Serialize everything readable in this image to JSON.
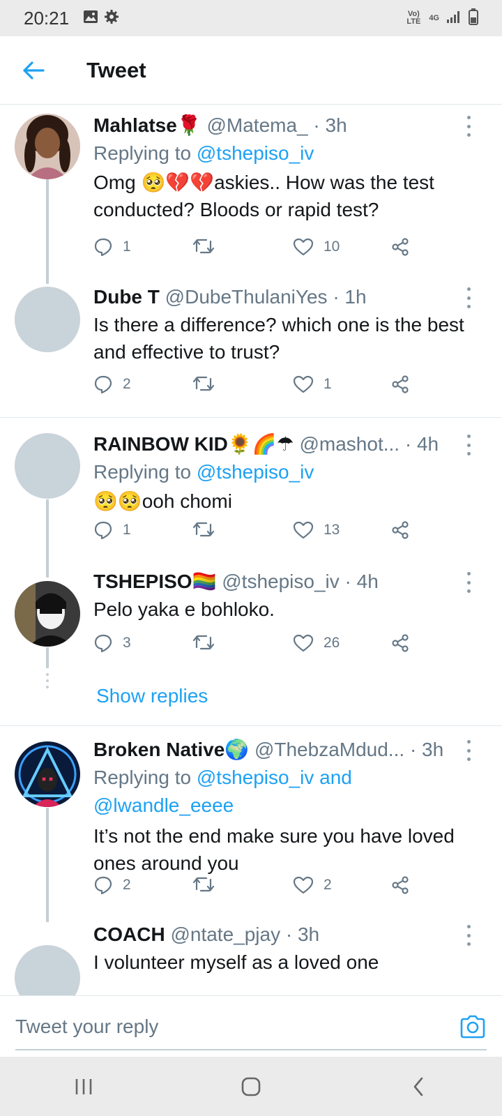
{
  "status_bar": {
    "time": "20:21",
    "network": "4G",
    "volte": "Vo) LTE"
  },
  "header": {
    "title": "Tweet"
  },
  "tweets": [
    {
      "name": "Mahlatse",
      "name_emoji": "🌹",
      "handle": "@Matema_",
      "time": "· 3h",
      "reply_prefix": "Replying to",
      "reply_to": "@tshepiso_iv",
      "text_pre": "Omg",
      "text_emoji": "🥺💔💔",
      "text_post": "askies.. How was the test conducted? Bloods or rapid test?",
      "replies": "1",
      "retweets": "",
      "likes": "10"
    },
    {
      "name": "Dube T",
      "handle": "@DubeThulaniYes",
      "time": "· 1h",
      "text": "Is there a difference? which one is the best and effective to trust?",
      "replies": "2",
      "retweets": "",
      "likes": "1"
    },
    {
      "name": "RAINBOW KID",
      "name_emoji": "🌻🌈☂",
      "handle": "@mashot...",
      "time": "· 4h",
      "reply_prefix": "Replying to",
      "reply_to": "@tshepiso_iv",
      "text_emoji": "🥺🥺",
      "text_post": "ooh chomi",
      "replies": "1",
      "retweets": "",
      "likes": "13"
    },
    {
      "name": "TSHEPISO",
      "name_emoji": "🏳️‍🌈",
      "handle": "@tshepiso_iv",
      "time": "· 4h",
      "text": "Pelo yaka e bohloko.",
      "replies": "3",
      "retweets": "",
      "likes": "26",
      "show_replies": "Show replies"
    },
    {
      "name": "Broken Native",
      "name_emoji": "🌍",
      "handle": "@ThebzaMdud...",
      "time": "· 3h",
      "reply_prefix": "Replying to",
      "reply_to": "@tshepiso_iv and",
      "reply_to_2": "@lwandle_eeee",
      "text": "It’s not the end make sure you have loved ones around you",
      "replies": "2",
      "retweets": "",
      "likes": "2"
    },
    {
      "name": "COACH",
      "handle": "@ntate_pjay",
      "time": "· 3h",
      "text": "I volunteer myself as a loved one"
    }
  ],
  "reply_bar": {
    "placeholder": "Tweet your reply"
  },
  "colors": {
    "link": "#1da1f2",
    "muted": "#657786",
    "text": "#14171a",
    "divider": "#e1e8ed"
  }
}
